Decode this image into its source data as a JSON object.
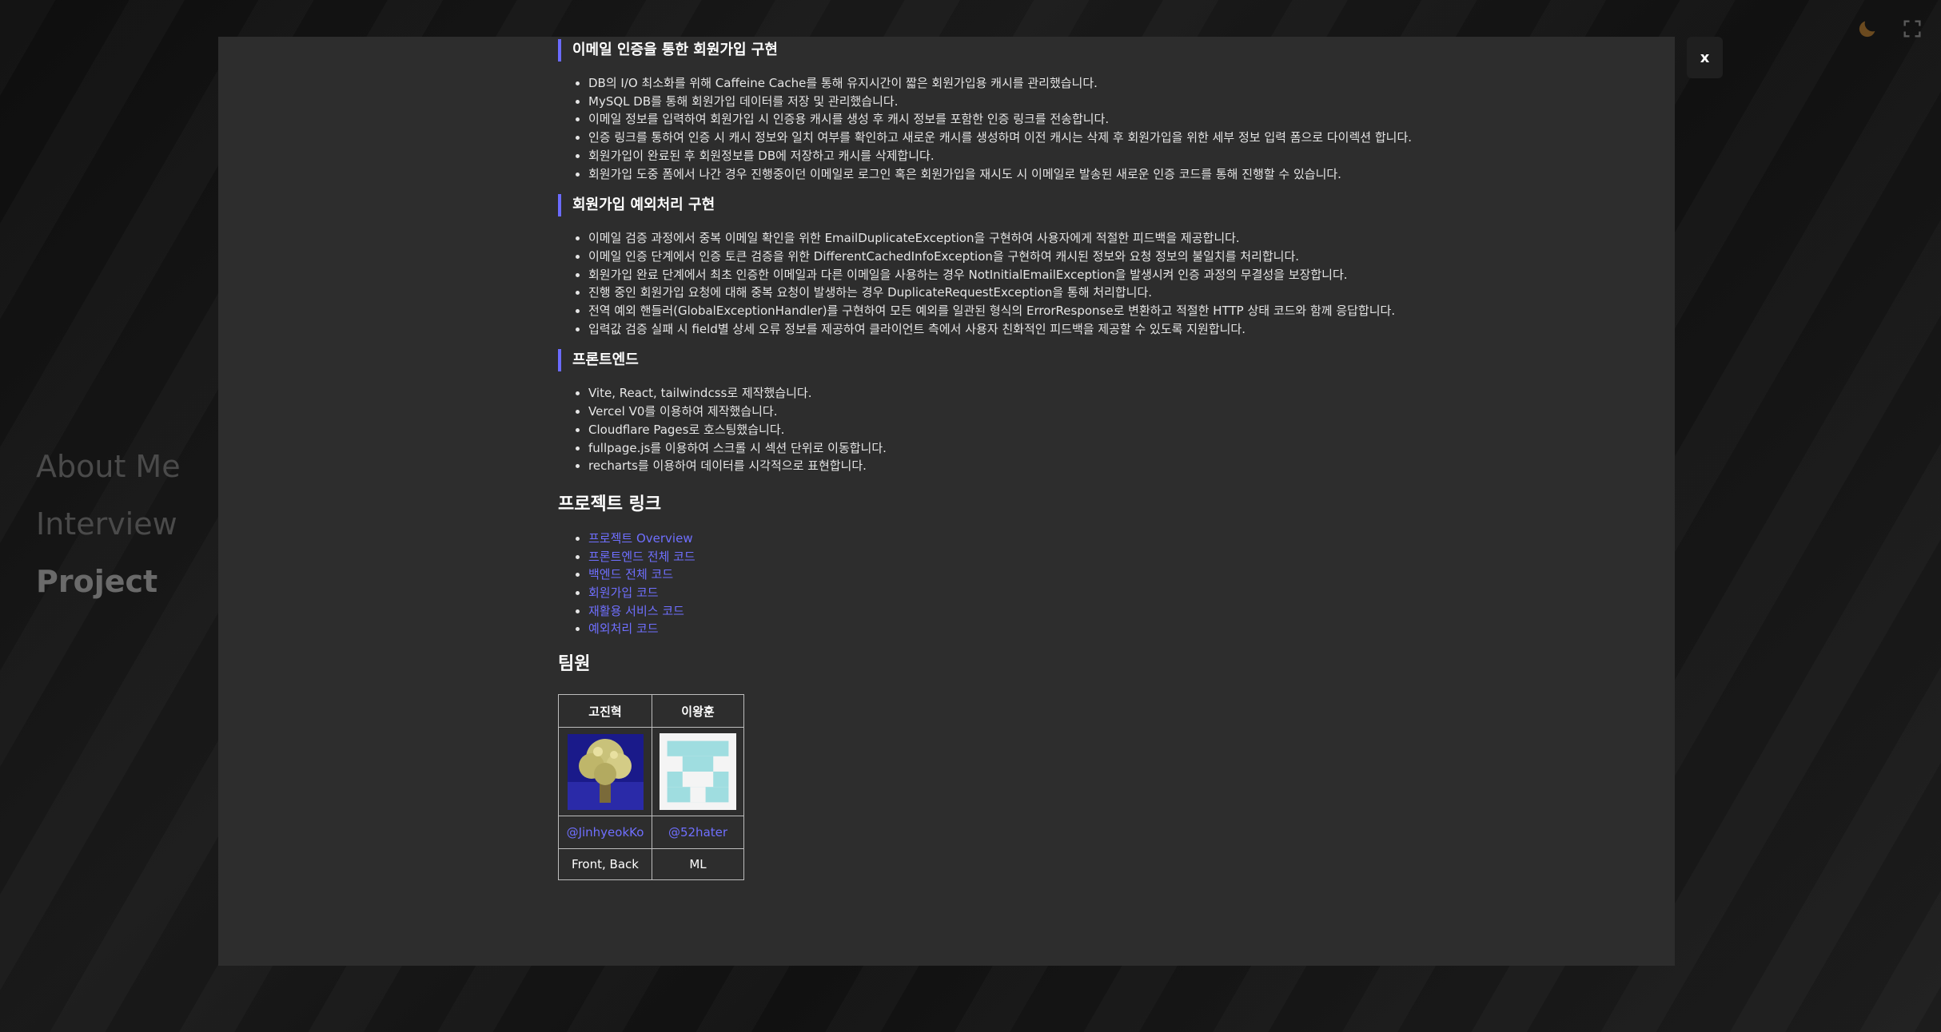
{
  "side_nav": {
    "items": [
      {
        "label": "About Me",
        "active": false
      },
      {
        "label": "Interview",
        "active": false
      },
      {
        "label": "Project",
        "active": true
      }
    ]
  },
  "top_icons": [
    "moon-icon",
    "fullscreen-icon"
  ],
  "modal": {
    "close_label": "x",
    "sections": [
      {
        "title": "이메일 인증을 통한 회원가입 구현",
        "items": [
          "DB의 I/O 최소화를 위해 Caffeine Cache를 통해 유지시간이 짧은 회원가입용 캐시를 관리했습니다.",
          "MySQL DB를 통해 회원가입 데이터를 저장 및 관리했습니다.",
          "이메일 정보를 입력하여 회원가입 시 인증용 캐시를 생성 후 캐시 정보를 포함한 인증 링크를 전송합니다.",
          "인증 링크를 통하여 인증 시 캐시 정보와 일치 여부를 확인하고 새로운 캐시를 생성하며 이전 캐시는 삭제 후 회원가입을 위한 세부 정보 입력 폼으로 다이렉션 합니다.",
          "회원가입이 완료된 후 회원정보를 DB에 저장하고 캐시를 삭제합니다.",
          "회원가입 도중 폼에서 나간 경우 진행중이던 이메일로 로그인 혹은 회원가입을 재시도 시 이메일로 발송된 새로운 인증 코드를 통해 진행할 수 있습니다."
        ]
      },
      {
        "title": "회원가입 예외처리 구현",
        "items": [
          "이메일 검증 과정에서 중복 이메일 확인을 위한 EmailDuplicateException을 구현하여 사용자에게 적절한 피드백을 제공합니다.",
          "이메일 인증 단계에서 인증 토큰 검증을 위한 DifferentCachedInfoException을 구현하여 캐시된 정보와 요청 정보의 불일치를 처리합니다.",
          "회원가입 완료 단계에서 최초 인증한 이메일과 다른 이메일을 사용하는 경우 NotInitialEmailException을 발생시켜 인증 과정의 무결성을 보장합니다.",
          "진행 중인 회원가입 요청에 대해 중복 요청이 발생하는 경우 DuplicateRequestException을 통해 처리합니다.",
          "전역 예외 핸들러(GlobalExceptionHandler)를 구현하여 모든 예외를 일관된 형식의 ErrorResponse로 변환하고 적절한 HTTP 상태 코드와 함께 응답합니다.",
          "입력값 검증 실패 시 field별 상세 오류 정보를 제공하여 클라이언트 측에서 사용자 친화적인 피드백을 제공할 수 있도록 지원합니다."
        ]
      },
      {
        "title": "프론트엔드",
        "items": [
          "Vite, React, tailwindcss로 제작했습니다.",
          "Vercel V0를 이용하여 제작했습니다.",
          "Cloudflare Pages로 호스팅했습니다.",
          "fullpage.js를 이용하여 스크롤 시 섹션 단위로 이동합니다.",
          "recharts를 이용하여 데이터를 시각적으로 표현합니다."
        ]
      }
    ],
    "links_title": "프로젝트 링크",
    "links": [
      "프로젝트 Overview",
      "프론트엔드 전체 코드",
      "백엔드 전체 코드",
      "회원가입 코드",
      "재활용 서비스 코드",
      "예외처리 코드"
    ],
    "team_title": "팀원",
    "team": [
      {
        "name": "고진혁",
        "handle": "@JinhyeokKo",
        "role": "Front, Back"
      },
      {
        "name": "이왕훈",
        "handle": "@52hater",
        "role": "ML"
      }
    ]
  }
}
